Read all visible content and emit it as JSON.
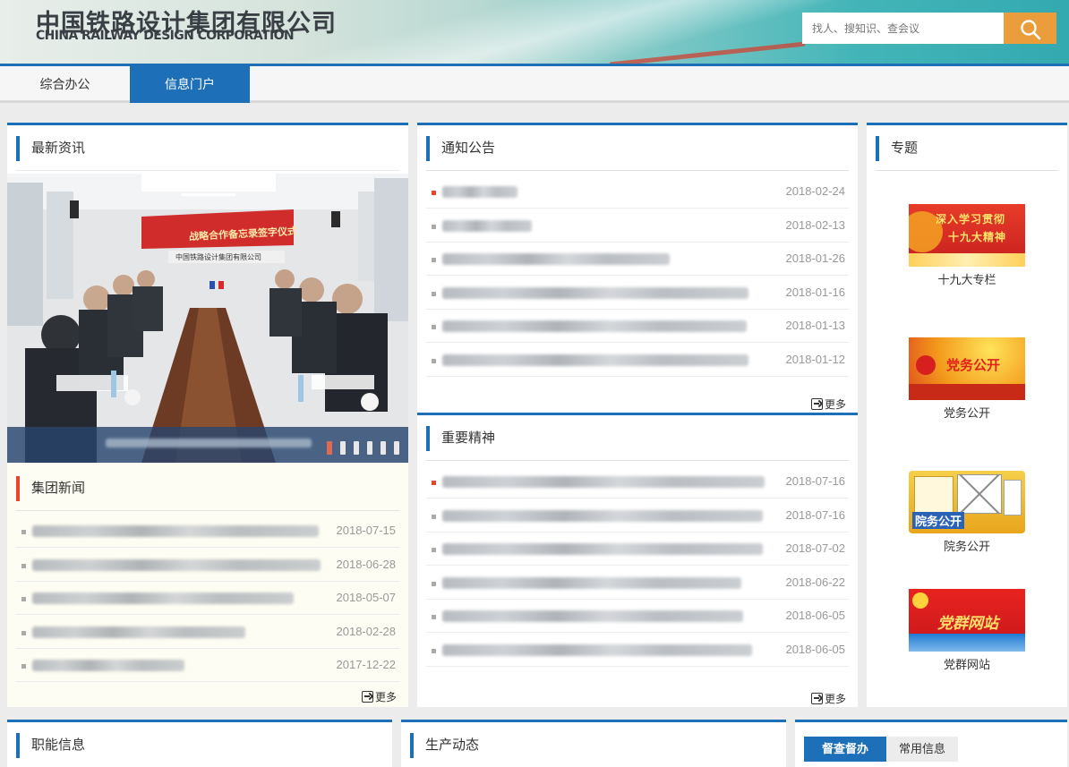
{
  "header": {
    "company_cn": "中国铁路设计集团有限公司",
    "company_en": "CHINA RAILWAY DESIGN CORPORATION",
    "search_placeholder": "找人、搜知识、查会议",
    "search_icon": "search-icon"
  },
  "nav": {
    "tabs": [
      {
        "label": "综合办公",
        "active": false
      },
      {
        "label": "信息门户",
        "active": true
      }
    ]
  },
  "latest": {
    "title": "最新资讯",
    "photo_banner": "战略合作备忘录签字仪式",
    "photo_subtitle": "中国铁路设计集团有限公司",
    "slide_count": 6,
    "active_slide": 1
  },
  "group_news": {
    "title": "集团新闻",
    "more": "更多",
    "items": [
      {
        "date": "2018-07-15"
      },
      {
        "date": "2018-06-28"
      },
      {
        "date": "2018-05-07"
      },
      {
        "date": "2018-02-28"
      },
      {
        "date": "2017-12-22"
      }
    ]
  },
  "notices": {
    "title": "通知公告",
    "more": "更多",
    "items": [
      {
        "date": "2018-02-24"
      },
      {
        "date": "2018-02-13"
      },
      {
        "date": "2018-01-26"
      },
      {
        "date": "2018-01-16"
      },
      {
        "date": "2018-01-13"
      },
      {
        "date": "2018-01-12"
      }
    ]
  },
  "spirit": {
    "title": "重要精神",
    "more": "更多",
    "items": [
      {
        "date": "2018-07-16"
      },
      {
        "date": "2018-07-16"
      },
      {
        "date": "2018-07-02"
      },
      {
        "date": "2018-06-22"
      },
      {
        "date": "2018-06-05"
      },
      {
        "date": "2018-06-05"
      }
    ]
  },
  "topics": {
    "title": "专题",
    "items": [
      {
        "label": "十九大专栏",
        "image_text": [
          "深入学习贯彻",
          "十九大精神"
        ]
      },
      {
        "label": "党务公开",
        "image_text": [
          "党务公开"
        ]
      },
      {
        "label": "院务公开",
        "image_text": [
          "院务公开"
        ]
      },
      {
        "label": "党群网站",
        "image_text": [
          "党群网站"
        ]
      }
    ]
  },
  "bottom": {
    "functional_title": "职能信息",
    "production_title": "生产动态",
    "tabs": [
      {
        "label": "督查督办",
        "active": true
      },
      {
        "label": "常用信息",
        "active": false
      }
    ]
  },
  "colors": {
    "brand_blue": "#1d6fb8",
    "search_orange": "#ec9d3b",
    "news_accent": "#e8462c"
  }
}
